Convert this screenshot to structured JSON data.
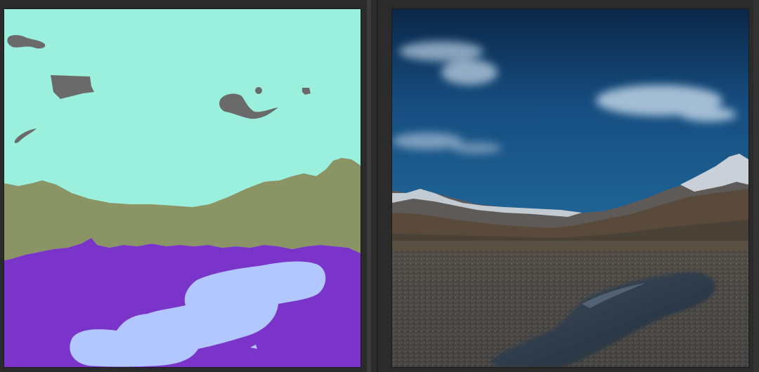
{
  "canvas": {
    "segmentation_label_colors": {
      "sky": "#9aefdd",
      "cloud": "#6a6a6a",
      "mountain": "#8b9464",
      "gravel": "#7a34c9",
      "water": "#b2c6ff"
    },
    "photo_palette": {
      "sky_top": "#0d2d55",
      "sky_bottom": "#1c5c8e",
      "cloud": "#cfe0ee",
      "snow": "#e6ebf2",
      "rock": "#5c5248",
      "ground": "#4a4a48",
      "water": "#2a3a4c"
    },
    "ui": {
      "background": "#2b2b2b",
      "divider": "#3a3a3a"
    }
  }
}
